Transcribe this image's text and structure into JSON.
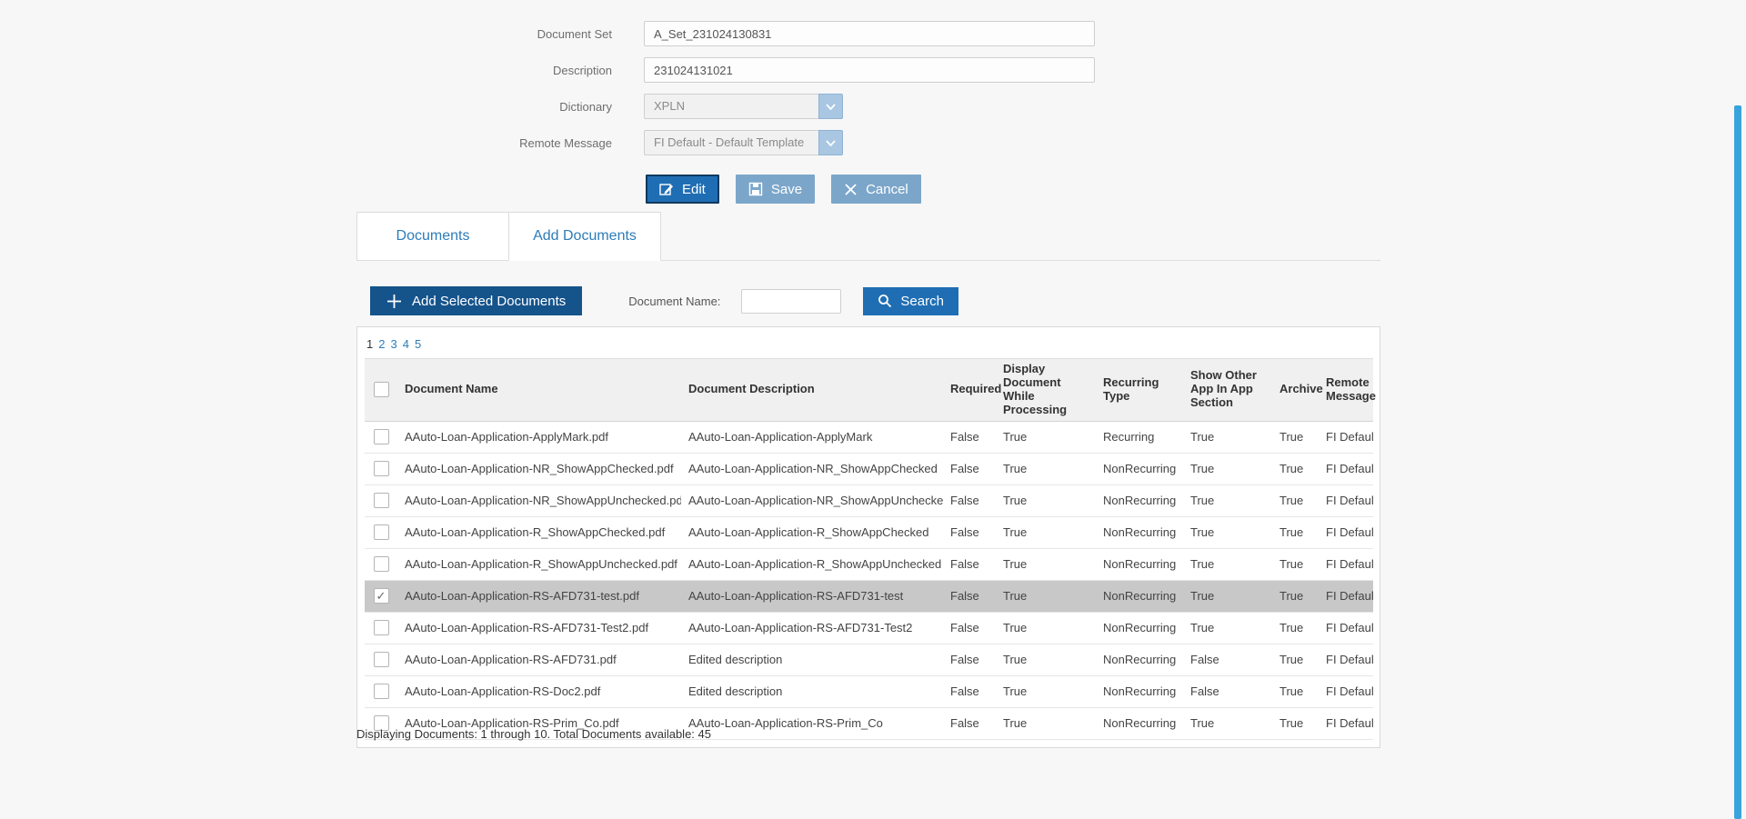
{
  "form": {
    "fields": [
      {
        "label": "Document Set",
        "value": "A_Set_231024130831"
      },
      {
        "label": "Description",
        "value": "231024131021"
      },
      {
        "label": "Dictionary",
        "value": "XPLN"
      },
      {
        "label": "Remote Message",
        "value": "FI Default - Default Template"
      }
    ]
  },
  "actions": {
    "edit": "Edit",
    "save": "Save",
    "cancel": "Cancel"
  },
  "tabs": [
    {
      "label": "Documents",
      "active": false
    },
    {
      "label": "Add Documents",
      "active": true
    }
  ],
  "toolbar": {
    "add_selected": "Add Selected Documents",
    "document_name_label": "Document Name:",
    "document_name_value": "",
    "search": "Search"
  },
  "pagination": {
    "pages": [
      "1",
      "2",
      "3",
      "4",
      "5"
    ],
    "current": "1"
  },
  "table": {
    "headers": [
      "Document Name",
      "Document Description",
      "Required",
      "Display Document While Processing",
      "Recurring Type",
      "Show Other App In App Section",
      "Archive",
      "Remote Message"
    ],
    "rows": [
      {
        "checked": false,
        "selected": false,
        "name": "AAuto-Loan-Application-ApplyMark.pdf",
        "description": "AAuto-Loan-Application-ApplyMark",
        "required": "False",
        "display_document": "True",
        "recurring_type": "Recurring",
        "show_other_app": "True",
        "archive": "True",
        "remote_message": "FI Default"
      },
      {
        "checked": false,
        "selected": false,
        "name": "AAuto-Loan-Application-NR_ShowAppChecked.pdf",
        "description": "AAuto-Loan-Application-NR_ShowAppChecked",
        "required": "False",
        "display_document": "True",
        "recurring_type": "NonRecurring",
        "show_other_app": "True",
        "archive": "True",
        "remote_message": "FI Default"
      },
      {
        "checked": false,
        "selected": false,
        "name": "AAuto-Loan-Application-NR_ShowAppUnchecked.pdf",
        "description": "AAuto-Loan-Application-NR_ShowAppUnchecked",
        "required": "False",
        "display_document": "True",
        "recurring_type": "NonRecurring",
        "show_other_app": "True",
        "archive": "True",
        "remote_message": "FI Default"
      },
      {
        "checked": false,
        "selected": false,
        "name": "AAuto-Loan-Application-R_ShowAppChecked.pdf",
        "description": "AAuto-Loan-Application-R_ShowAppChecked",
        "required": "False",
        "display_document": "True",
        "recurring_type": "NonRecurring",
        "show_other_app": "True",
        "archive": "True",
        "remote_message": "FI Default"
      },
      {
        "checked": false,
        "selected": false,
        "name": "AAuto-Loan-Application-R_ShowAppUnchecked.pdf",
        "description": "AAuto-Loan-Application-R_ShowAppUnchecked",
        "required": "False",
        "display_document": "True",
        "recurring_type": "NonRecurring",
        "show_other_app": "True",
        "archive": "True",
        "remote_message": "FI Default"
      },
      {
        "checked": true,
        "selected": true,
        "name": "AAuto-Loan-Application-RS-AFD731-test.pdf",
        "description": "AAuto-Loan-Application-RS-AFD731-test",
        "required": "False",
        "display_document": "True",
        "recurring_type": "NonRecurring",
        "show_other_app": "True",
        "archive": "True",
        "remote_message": "FI Default"
      },
      {
        "checked": false,
        "selected": false,
        "name": "AAuto-Loan-Application-RS-AFD731-Test2.pdf",
        "description": "AAuto-Loan-Application-RS-AFD731-Test2",
        "required": "False",
        "display_document": "True",
        "recurring_type": "NonRecurring",
        "show_other_app": "True",
        "archive": "True",
        "remote_message": "FI Default"
      },
      {
        "checked": false,
        "selected": false,
        "name": "AAuto-Loan-Application-RS-AFD731.pdf",
        "description": "Edited description",
        "required": "False",
        "display_document": "True",
        "recurring_type": "NonRecurring",
        "show_other_app": "False",
        "archive": "True",
        "remote_message": "FI Default"
      },
      {
        "checked": false,
        "selected": false,
        "name": "AAuto-Loan-Application-RS-Doc2.pdf",
        "description": "Edited description",
        "required": "False",
        "display_document": "True",
        "recurring_type": "NonRecurring",
        "show_other_app": "False",
        "archive": "True",
        "remote_message": "FI Default"
      },
      {
        "checked": false,
        "selected": false,
        "name": "AAuto-Loan-Application-RS-Prim_Co.pdf",
        "description": "AAuto-Loan-Application-RS-Prim_Co",
        "required": "False",
        "display_document": "True",
        "recurring_type": "NonRecurring",
        "show_other_app": "True",
        "archive": "True",
        "remote_message": "FI Default"
      }
    ]
  },
  "footer": {
    "summary": "Displaying Documents: 1 through 10. Total Documents available: 45"
  },
  "colors": {
    "primary_blue": "#1f6eb4",
    "dark_navy": "#15538b",
    "light_blue_button": "#7ba6ca",
    "link_blue": "#2d7cb9",
    "selected_row": "#c8c8c8",
    "scroll_strip": "#39a3dc"
  }
}
